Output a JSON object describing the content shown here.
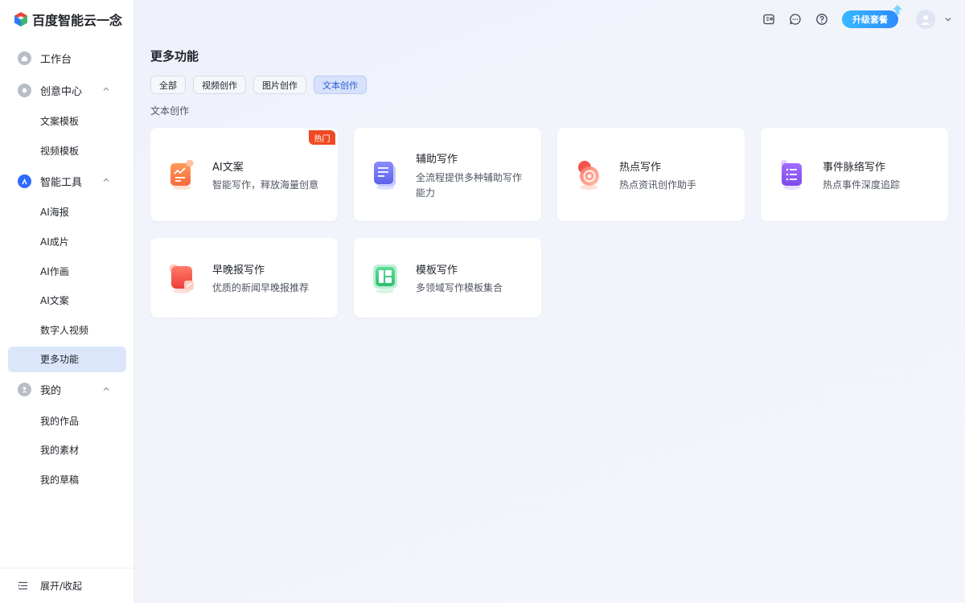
{
  "app": {
    "logo_text": "百度智能云一念"
  },
  "sidebar": {
    "workspace": "工作台",
    "groups": [
      {
        "label": "创意中心",
        "items": [
          "文案模板",
          "视频模板"
        ]
      },
      {
        "label": "智能工具",
        "items": [
          "AI海报",
          "AI成片",
          "AI作画",
          "AI文案",
          "数字人视频",
          "更多功能"
        ]
      },
      {
        "label": "我的",
        "items": [
          "我的作品",
          "我的素材",
          "我的草稿"
        ]
      }
    ],
    "active_item": "更多功能",
    "footer_label": "展开/收起"
  },
  "topbar": {
    "upgrade_label": "升级套餐"
  },
  "main": {
    "title": "更多功能",
    "tabs": [
      "全部",
      "视频创作",
      "图片创作",
      "文本创作"
    ],
    "active_tab": "文本创作",
    "section_label": "文本创作",
    "cards": [
      {
        "title": "AI文案",
        "desc": "智能写作，释放海量创意",
        "badge": "热门",
        "icon": "ai-copy-icon"
      },
      {
        "title": "辅助写作",
        "desc": "全流程提供多种辅助写作能力",
        "icon": "assist-writing-icon"
      },
      {
        "title": "热点写作",
        "desc": "热点资讯创作助手",
        "icon": "hotspot-icon"
      },
      {
        "title": "事件脉络写作",
        "desc": "热点事件深度追踪",
        "icon": "event-timeline-icon"
      },
      {
        "title": "早晚报写作",
        "desc": "优质的新闻早晚报推荐",
        "icon": "daily-report-icon"
      },
      {
        "title": "模板写作",
        "desc": "多领域写作模板集合",
        "icon": "template-icon"
      }
    ]
  },
  "colors": {
    "accent": "#2f6bff",
    "hot_badge": "#ef4a24",
    "active_bg": "#dce6fb"
  }
}
